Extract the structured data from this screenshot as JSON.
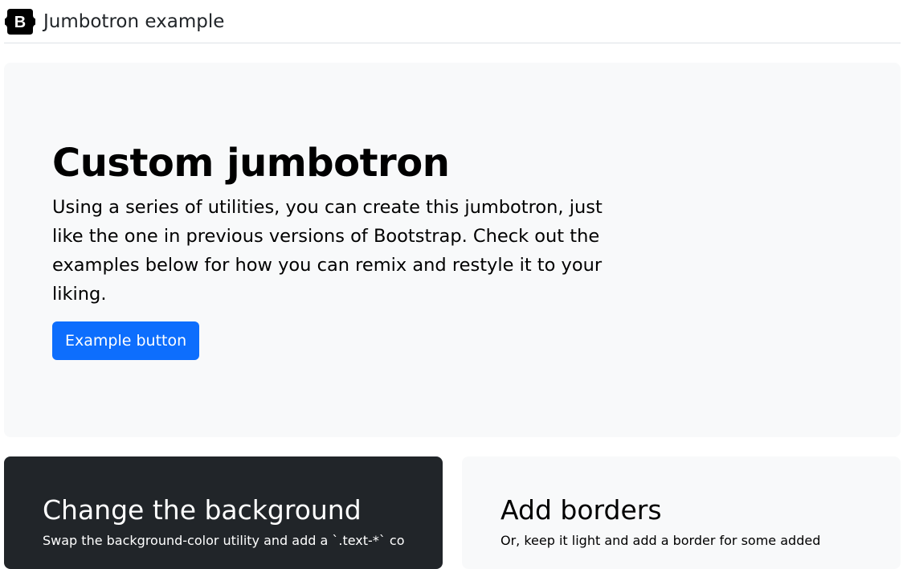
{
  "header": {
    "logo_icon": "bootstrap-logo-icon",
    "logo_letter": "B",
    "title": "Jumbotron example"
  },
  "jumbotron": {
    "heading": "Custom jumbotron",
    "lead": "Using a series of utilities, you can create this jumbotron, just like the one in previous versions of Bootstrap. Check out the examples below for how you can remix and restyle it to your liking.",
    "button_label": "Example button"
  },
  "cards": {
    "dark": {
      "heading": "Change the background",
      "text": "Swap the background-color utility and add a `.text-*` color"
    },
    "light": {
      "heading": "Add borders",
      "text": "Or, keep it light and add a border for some added"
    }
  },
  "colors": {
    "primary": "#0d6efd",
    "dark": "#212529",
    "light": "#f8f9fa",
    "border": "#dee2e6"
  }
}
